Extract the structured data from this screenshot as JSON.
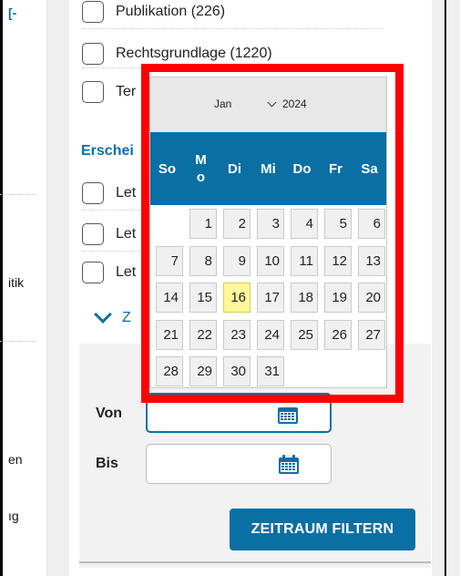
{
  "left_column": {
    "fragments": [
      "[-",
      "itik",
      "en",
      "ıg"
    ]
  },
  "checkboxes_top": [
    {
      "label": "Publikation (226)"
    },
    {
      "label": "Rechtsgrundlage (1220)"
    },
    {
      "label": "Ter"
    }
  ],
  "section": {
    "title": "Erschei"
  },
  "checkboxes_bottom": [
    {
      "label": "Let"
    },
    {
      "label": "Let"
    },
    {
      "label": "Let"
    }
  ],
  "expander": {
    "label": "Z"
  },
  "filter": {
    "von_label": "Von",
    "bis_label": "Bis",
    "von_value": "",
    "bis_value": "",
    "button_label": "ZEITRAUM FILTERN"
  },
  "datepicker": {
    "month": "Jan",
    "year": "2024",
    "weekdays": [
      "So",
      "Mo",
      "Di",
      "Mi",
      "Do",
      "Fr",
      "Sa"
    ],
    "weekday_display": [
      "So",
      "M\no",
      "Di",
      "Mi",
      "Do",
      "Fr",
      "Sa"
    ],
    "first_weekday_index": 1,
    "days_in_month": 31,
    "today": 16
  },
  "colors": {
    "accent": "#0a6fa3",
    "highlight_frame": "#ff0000",
    "today_bg": "#fff79a"
  }
}
